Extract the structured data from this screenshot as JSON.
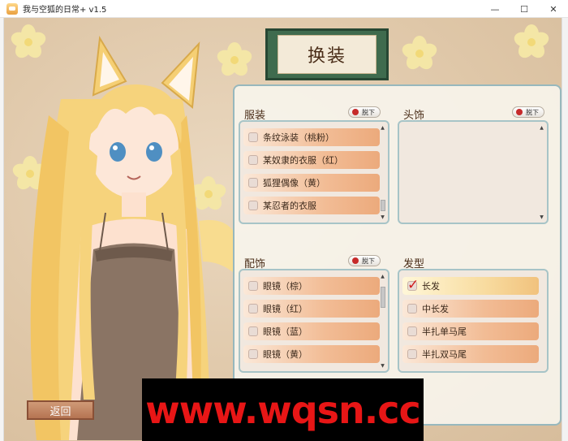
{
  "window": {
    "title": "我与空狐的日常+ v1.5",
    "minimize_icon": "minimize-icon",
    "maximize_icon": "maximize-icon",
    "close_icon": "close-icon"
  },
  "banner": {
    "title": "换装"
  },
  "sections": {
    "clothing": {
      "label": "服装",
      "remove_label": "脱下",
      "items": [
        {
          "label": "条纹泳装（桃粉）",
          "checked": false
        },
        {
          "label": "某奴隶的衣服（红）",
          "checked": false
        },
        {
          "label": "狐狸偶像（黄）",
          "checked": false
        },
        {
          "label": "某忍者的衣服",
          "checked": false
        }
      ]
    },
    "headwear": {
      "label": "头饰",
      "remove_label": "脱下",
      "items": []
    },
    "accessories": {
      "label": "配饰",
      "remove_label": "脱下",
      "items": [
        {
          "label": "眼镜（棕）",
          "checked": false
        },
        {
          "label": "眼镜（红）",
          "checked": false
        },
        {
          "label": "眼镜（蓝）",
          "checked": false
        },
        {
          "label": "眼镜（黄）",
          "checked": false
        }
      ]
    },
    "hairstyle": {
      "label": "发型",
      "items": [
        {
          "label": "长发",
          "checked": true
        },
        {
          "label": "中长发",
          "checked": false
        },
        {
          "label": "半扎单马尾",
          "checked": false
        },
        {
          "label": "半扎双马尾",
          "checked": false
        }
      ]
    }
  },
  "buttons": {
    "back": "返回"
  },
  "watermark": "www.wqsn.cc",
  "colors": {
    "banner_frame": "#3f6b4e",
    "panel_border": "#97b8bd",
    "item_gradient_end": "#ecaa7c",
    "check_mark": "#d11c1c",
    "watermark_text": "#e81616"
  }
}
